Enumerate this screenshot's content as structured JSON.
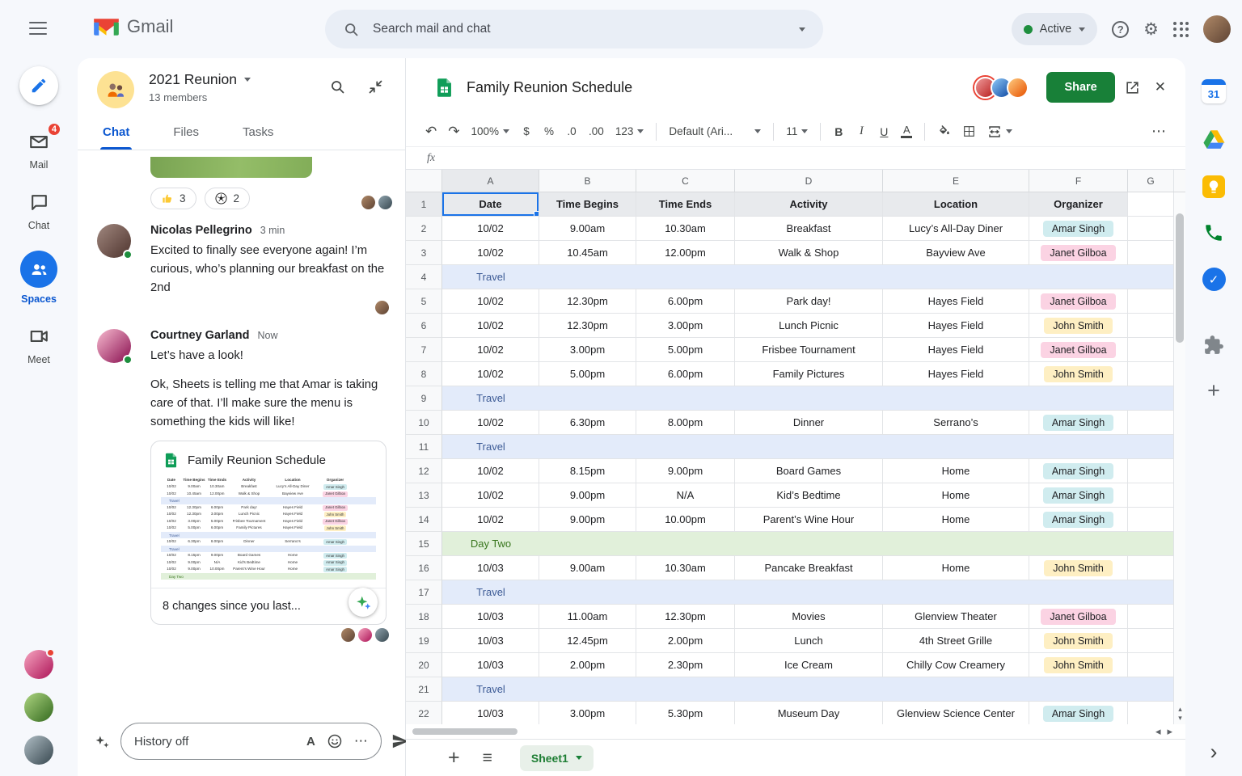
{
  "topbar": {
    "app_name": "Gmail",
    "search_placeholder": "Search mail and chat",
    "status_label": "Active"
  },
  "left_nav": {
    "mail_label": "Mail",
    "mail_badge": "4",
    "chat_label": "Chat",
    "spaces_label": "Spaces",
    "meet_label": "Meet"
  },
  "chat": {
    "space_name": "2021 Reunion",
    "members": "13 members",
    "tabs": {
      "chat": "Chat",
      "files": "Files",
      "tasks": "Tasks"
    },
    "reactions": [
      {
        "name": "thumbs-up",
        "count": "3"
      },
      {
        "name": "soccer-ball",
        "count": "2"
      }
    ],
    "messages": [
      {
        "author": "Nicolas Pellegrino",
        "time": "3 min",
        "lines": [
          "Excited to finally see everyone again! I’m curious, who’s planning our breakfast on the 2nd"
        ]
      },
      {
        "author": "Courtney Garland",
        "time": "Now",
        "lines": [
          "Let’s have a look!",
          "Ok, Sheets is telling me that Amar is taking care of that. I’ll make sure the menu is something the kids will like!"
        ]
      }
    ],
    "card": {
      "title": "Family Reunion Schedule",
      "footer": "8 changes since you last..."
    },
    "composer": {
      "value": "History off"
    }
  },
  "sheets": {
    "title": "Family Reunion Schedule",
    "share_label": "Share",
    "toolbar": {
      "zoom": "100%",
      "currency": "$",
      "percent": "%",
      "dec_dec": ".0",
      "dec_inc": ".00",
      "number_fmt": "123",
      "font_name": "Default (Ari...",
      "font_size": "11",
      "bold": "B",
      "italic": "I",
      "underline": "U",
      "color": "A"
    },
    "formula_label": "fx",
    "columns": [
      "A",
      "B",
      "C",
      "D",
      "E",
      "F",
      "G"
    ],
    "grid": {
      "header": [
        "Date",
        "Time Begins",
        "Time Ends",
        "Activity",
        "Location",
        "Organizer"
      ],
      "rows": [
        {
          "n": 2,
          "cells": [
            "10/02",
            "9.00am",
            "10.30am",
            "Breakfast",
            "Lucy’s All-Day Diner"
          ],
          "organizer": "Amar Singh"
        },
        {
          "n": 3,
          "cells": [
            "10/02",
            "10.45am",
            "12.00pm",
            "Walk & Shop",
            "Bayview Ave"
          ],
          "organizer": "Janet Gilboa"
        },
        {
          "n": 4,
          "band": "Travel"
        },
        {
          "n": 5,
          "cells": [
            "10/02",
            "12.30pm",
            "6.00pm",
            "Park day!",
            "Hayes Field"
          ],
          "organizer": "Janet Gilboa"
        },
        {
          "n": 6,
          "cells": [
            "10/02",
            "12.30pm",
            "3.00pm",
            "Lunch Picnic",
            "Hayes Field"
          ],
          "organizer": "John Smith"
        },
        {
          "n": 7,
          "cells": [
            "10/02",
            "3.00pm",
            "5.00pm",
            "Frisbee Tournament",
            "Hayes Field"
          ],
          "organizer": "Janet Gilboa"
        },
        {
          "n": 8,
          "cells": [
            "10/02",
            "5.00pm",
            "6.00pm",
            "Family Pictures",
            "Hayes Field"
          ],
          "organizer": "John Smith"
        },
        {
          "n": 9,
          "band": "Travel"
        },
        {
          "n": 10,
          "cells": [
            "10/02",
            "6.30pm",
            "8.00pm",
            "Dinner",
            "Serrano’s"
          ],
          "organizer": "Amar Singh"
        },
        {
          "n": 11,
          "band": "Travel"
        },
        {
          "n": 12,
          "cells": [
            "10/02",
            "8.15pm",
            "9.00pm",
            "Board Games",
            "Home"
          ],
          "organizer": "Amar Singh"
        },
        {
          "n": 13,
          "cells": [
            "10/02",
            "9.00pm",
            "N/A",
            "Kid’s Bedtime",
            "Home"
          ],
          "organizer": "Amar Singh"
        },
        {
          "n": 14,
          "cells": [
            "10/02",
            "9.00pm",
            "10.00pm",
            "Parent’s Wine Hour",
            "Home"
          ],
          "organizer": "Amar Singh"
        },
        {
          "n": 15,
          "band": "Day Two"
        },
        {
          "n": 16,
          "cells": [
            "10/03",
            "9.00am",
            "10.30am",
            "Pancake Breakfast",
            "Home"
          ],
          "organizer": "John Smith"
        },
        {
          "n": 17,
          "band": "Travel"
        },
        {
          "n": 18,
          "cells": [
            "10/03",
            "11.00am",
            "12.30pm",
            "Movies",
            "Glenview Theater"
          ],
          "organizer": "Janet Gilboa"
        },
        {
          "n": 19,
          "cells": [
            "10/03",
            "12.45pm",
            "2.00pm",
            "Lunch",
            "4th Street Grille"
          ],
          "organizer": "John Smith"
        },
        {
          "n": 20,
          "cells": [
            "10/03",
            "2.00pm",
            "2.30pm",
            "Ice Cream",
            "Chilly Cow Creamery"
          ],
          "organizer": "John Smith"
        },
        {
          "n": 21,
          "band": "Travel"
        },
        {
          "n": 22,
          "cells": [
            "10/03",
            "3.00pm",
            "5.30pm",
            "Museum Day",
            "Glenview Science Center"
          ],
          "organizer": "Amar Singh"
        }
      ],
      "organizer_colors": {
        "Amar Singh": "#d0ecef",
        "Janet Gilboa": "#fbd3e3",
        "John Smith": "#feefc3"
      },
      "band_styles": {
        "Travel": {
          "bg": "#e3ebfa",
          "fg": "#3d5b96"
        },
        "Day Two": {
          "bg": "#e1f0da",
          "fg": "#38761d"
        }
      }
    },
    "sheet_tab": "Sheet1"
  },
  "side_rail": {
    "calendar_label": "31"
  },
  "colors": {
    "share_green": "#188038",
    "selection_blue": "#1a73e8",
    "active_dot_green": "#1e8e3e",
    "badge_red": "#ea4335"
  }
}
